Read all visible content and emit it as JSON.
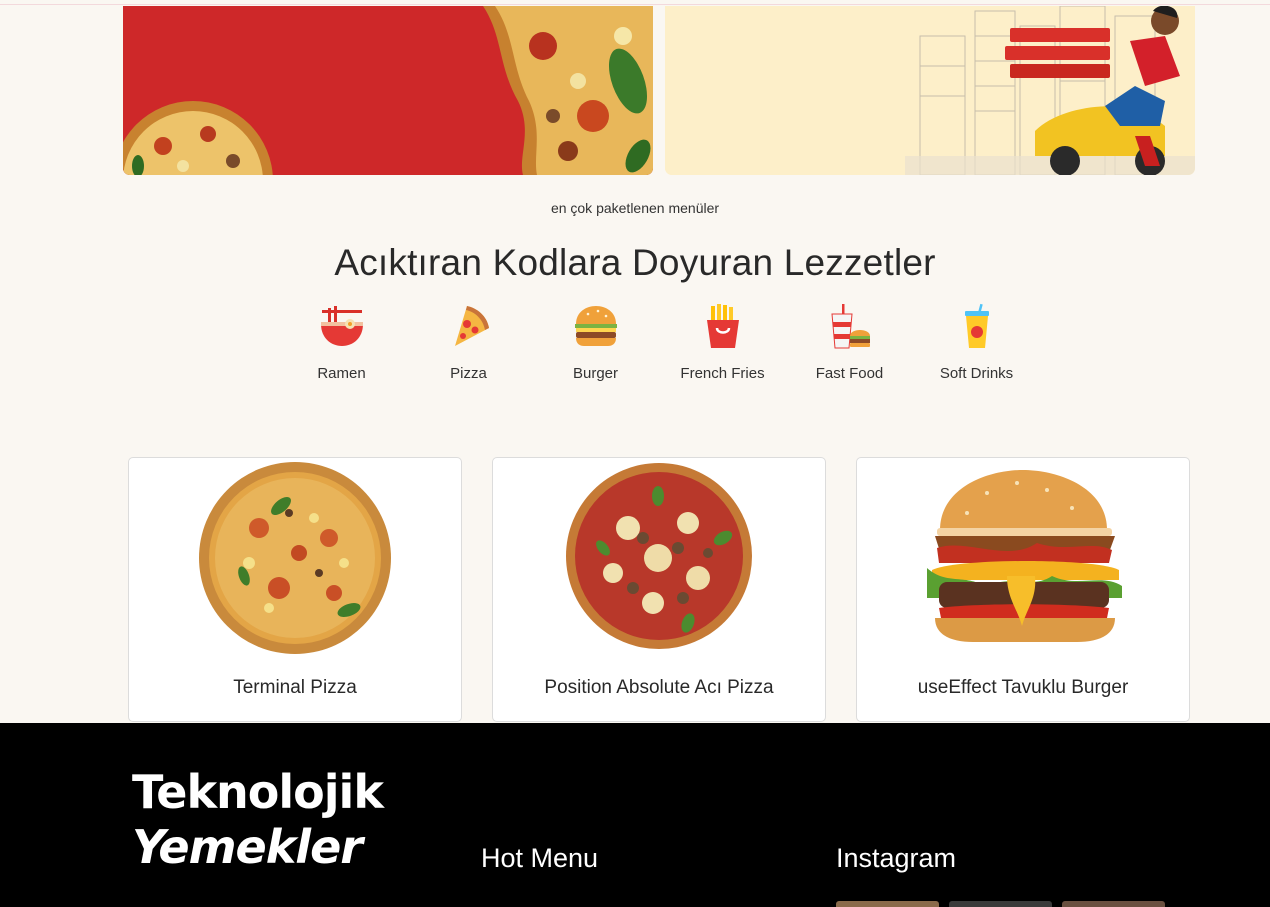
{
  "section": {
    "subtitle": "en çok paketlenen menüler",
    "title": "Acıktıran Kodlara Doyuran Lezzetler"
  },
  "categories": [
    {
      "label": "Ramen",
      "icon": "ramen-bowl-icon"
    },
    {
      "label": "Pizza",
      "icon": "pizza-slice-icon"
    },
    {
      "label": "Burger",
      "icon": "burger-icon"
    },
    {
      "label": "French Fries",
      "icon": "french-fries-icon"
    },
    {
      "label": "Fast Food",
      "icon": "fast-food-icon"
    },
    {
      "label": "Soft Drinks",
      "icon": "soft-drink-icon"
    }
  ],
  "cards": [
    {
      "name": "Terminal Pizza"
    },
    {
      "name": "Position Absolute Acı Pizza"
    },
    {
      "name": "useEffect Tavuklu Burger"
    }
  ],
  "footer": {
    "logo_line1": "Teknolojik",
    "logo_line2": "Yemekler",
    "hot_menu": "Hot Menu",
    "instagram": "Instagram"
  },
  "colors": {
    "page_bg": "#faf7f2",
    "brand_red": "#ce2829",
    "banner_cream": "#fdefc9",
    "footer_bg": "#000000"
  }
}
